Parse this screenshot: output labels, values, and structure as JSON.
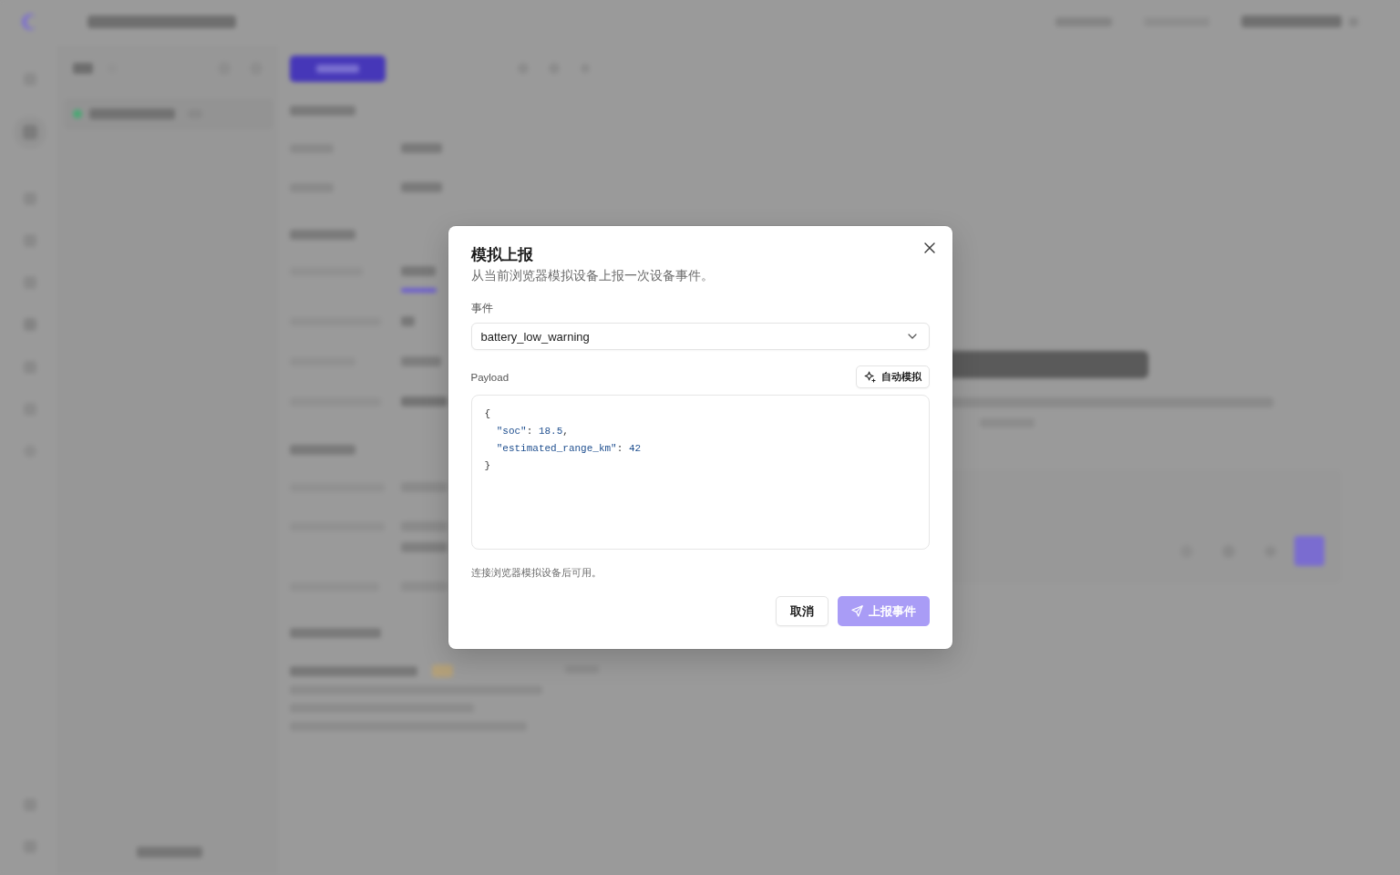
{
  "dialog": {
    "title": "模拟上报",
    "description": "从当前浏览器模拟设备上报一次设备事件。",
    "event_field": {
      "label": "事件",
      "value": "battery_low_warning"
    },
    "payload": {
      "label": "Payload",
      "auto_button": {
        "label": "自动模拟"
      },
      "value": "{\n  \"soc\": 18.5,\n  \"estimated_range_km\": 42\n}"
    },
    "hint": "连接浏览器模拟设备后可用。",
    "buttons": [
      {
        "label": "取消",
        "kind": "secondary",
        "disabled": false
      },
      {
        "label": "上报事件",
        "kind": "primary",
        "disabled": true
      }
    ]
  }
}
